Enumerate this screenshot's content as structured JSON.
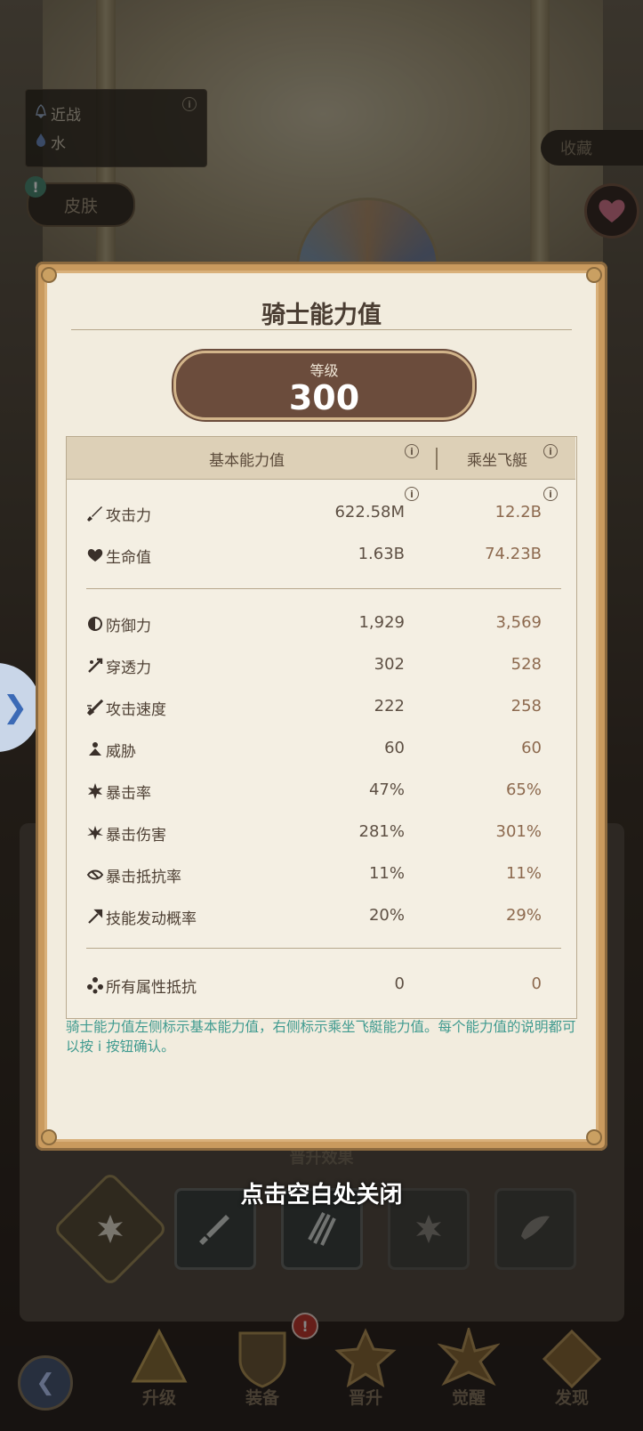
{
  "background": {
    "attributes": [
      {
        "label": "近战",
        "icon": "hand-bell-icon"
      },
      {
        "label": "水",
        "icon": "water-drop-icon"
      }
    ],
    "skin_button": "皮肤",
    "collect_button": "收藏"
  },
  "modal": {
    "title": "骑士能力值",
    "level_label": "等级",
    "level_value": "300",
    "columns": {
      "base": "基本能力值",
      "ride": "乘坐飞艇"
    },
    "stats_group1": [
      {
        "name": "攻击力",
        "icon": "sword-icon",
        "base": "622.58M",
        "ride": "12.2B"
      },
      {
        "name": "生命值",
        "icon": "heart-icon",
        "base": "1.63B",
        "ride": "74.23B"
      }
    ],
    "stats_group2": [
      {
        "name": "防御力",
        "icon": "shield-half-icon",
        "base": "1,929",
        "ride": "3,569"
      },
      {
        "name": "穿透力",
        "icon": "pierce-icon",
        "base": "302",
        "ride": "528"
      },
      {
        "name": "攻击速度",
        "icon": "attack-speed-icon",
        "base": "222",
        "ride": "258"
      },
      {
        "name": "威胁",
        "icon": "threat-icon",
        "base": "60",
        "ride": "60"
      },
      {
        "name": "暴击率",
        "icon": "crit-rate-icon",
        "base": "47%",
        "ride": "65%"
      },
      {
        "name": "暴击伤害",
        "icon": "crit-damage-icon",
        "base": "281%",
        "ride": "301%"
      },
      {
        "name": "暴击抵抗率",
        "icon": "crit-resist-icon",
        "base": "11%",
        "ride": "11%"
      },
      {
        "name": "技能发动概率",
        "icon": "skill-trigger-icon",
        "base": "20%",
        "ride": "29%"
      }
    ],
    "stats_group3": [
      {
        "name": "所有属性抵抗",
        "icon": "all-resist-icon",
        "base": "0",
        "ride": "0"
      }
    ],
    "note": "骑士能力值左侧标示基本能力值，右侧标示乘坐飞艇能力值。每个能力值的说明都可以按 i 按钮确认。"
  },
  "promotion_title": "晋升效果",
  "close_hint": "点击空白处关闭",
  "nav": {
    "items": [
      {
        "label": "升级",
        "icon": "upgrade-icon"
      },
      {
        "label": "装备",
        "icon": "equipment-icon"
      },
      {
        "label": "晋升",
        "icon": "promotion-icon"
      },
      {
        "label": "觉醒",
        "icon": "awaken-icon"
      },
      {
        "label": "发现",
        "icon": "discover-icon"
      }
    ],
    "equip_badge": "!"
  },
  "colors": {
    "accent_text": "#3f9a8f",
    "modal_border": "#c99a5e",
    "level_bg": "#6b4c3c"
  }
}
